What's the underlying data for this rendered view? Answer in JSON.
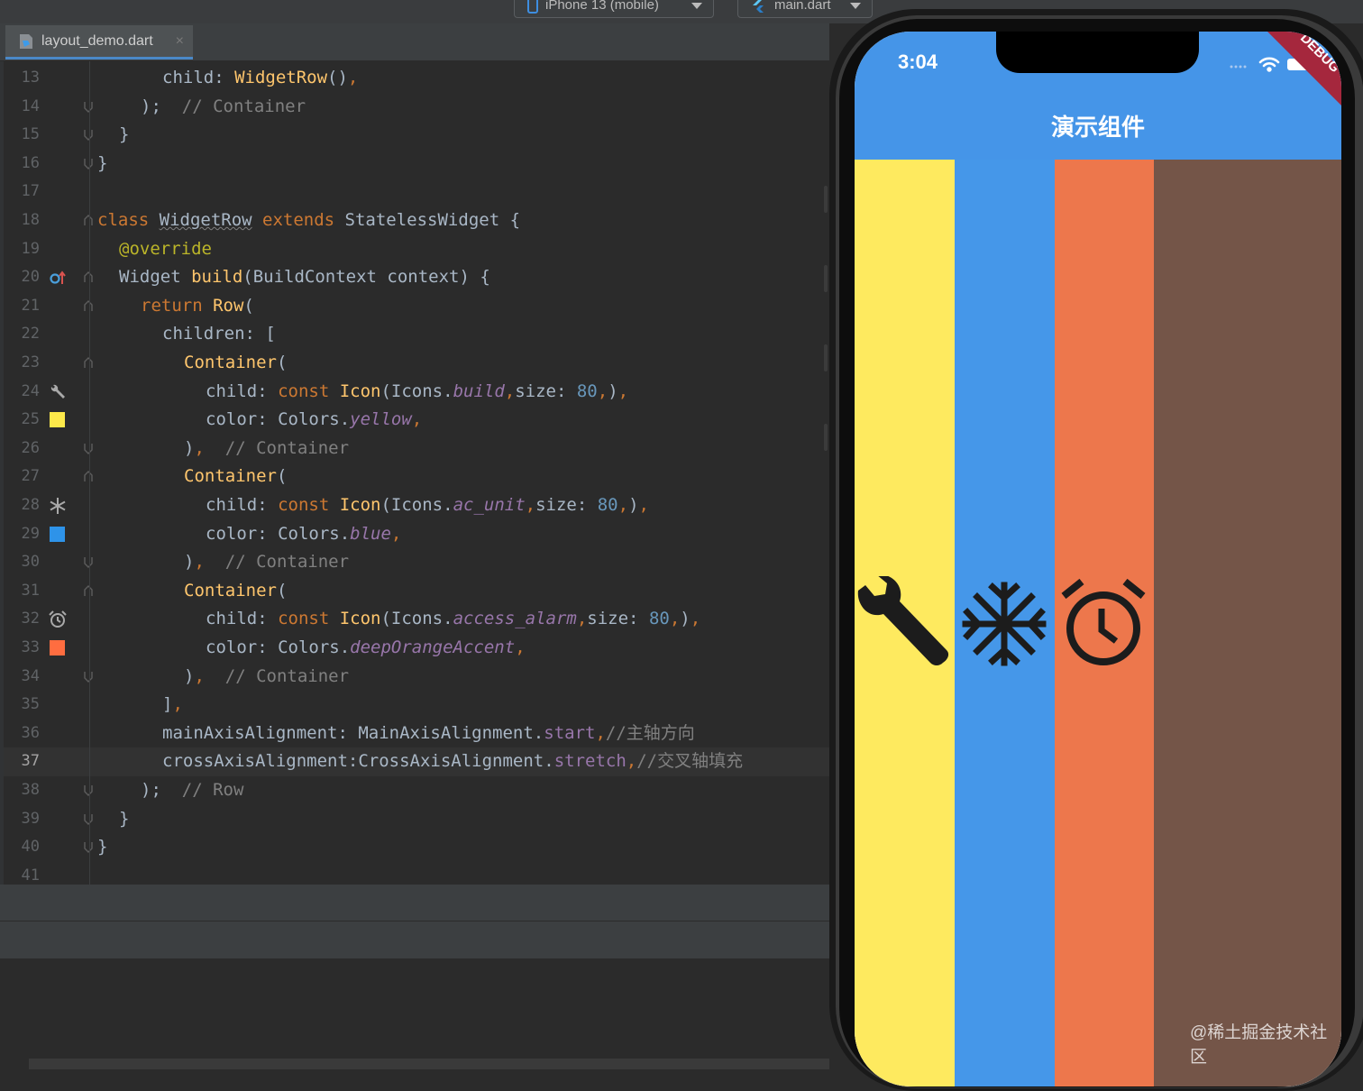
{
  "toolbar": {
    "device": "iPhone 13 (mobile)",
    "config": "main.dart"
  },
  "tab": {
    "filename": "layout_demo.dart",
    "close": "×"
  },
  "code_lines": [
    {
      "n": "13"
    },
    {
      "n": "14"
    },
    {
      "n": "15"
    },
    {
      "n": "16"
    },
    {
      "n": "17"
    },
    {
      "n": "18"
    },
    {
      "n": "19"
    },
    {
      "n": "20"
    },
    {
      "n": "21"
    },
    {
      "n": "22"
    },
    {
      "n": "23"
    },
    {
      "n": "24"
    },
    {
      "n": "25"
    },
    {
      "n": "26"
    },
    {
      "n": "27"
    },
    {
      "n": "28"
    },
    {
      "n": "29"
    },
    {
      "n": "30"
    },
    {
      "n": "31"
    },
    {
      "n": "32"
    },
    {
      "n": "33"
    },
    {
      "n": "34"
    },
    {
      "n": "35"
    },
    {
      "n": "36"
    },
    {
      "n": "37"
    },
    {
      "n": "38"
    },
    {
      "n": "39"
    },
    {
      "n": "40"
    },
    {
      "n": "41"
    }
  ],
  "code": {
    "l13": {
      "a": "child: ",
      "b": "WidgetRow",
      "c": "()",
      "d": ","
    },
    "l14": {
      "a": "); ",
      "b": "// Container"
    },
    "l15": {
      "a": "}"
    },
    "l16": {
      "a": "}"
    },
    "l18": {
      "a": "class ",
      "b": "WidgetRow",
      "c": " extends ",
      "d": "StatelessWidget {"
    },
    "l19": {
      "a": "@override"
    },
    "l20": {
      "a": "Widget ",
      "b": "build",
      "c": "(BuildContext context) {"
    },
    "l21": {
      "a": "return ",
      "b": "Row",
      "c": "("
    },
    "l22": {
      "a": "children: ["
    },
    "l23": {
      "a": "Container",
      "b": "("
    },
    "l24": {
      "a": "child: ",
      "b": "const ",
      "c": "Icon",
      "d": "(Icons.",
      "e": "build",
      "f": ",",
      "g": "size: ",
      "h": "80",
      "i": ",",
      "j": ")",
      "k": ","
    },
    "l25": {
      "a": "color: Colors.",
      "b": "yellow",
      "c": ","
    },
    "l26": {
      "a": ")",
      "b": ",  ",
      "c": "// Container"
    },
    "l27": {
      "a": "Container",
      "b": "("
    },
    "l28": {
      "a": "child: ",
      "b": "const ",
      "c": "Icon",
      "d": "(Icons.",
      "e": "ac_unit",
      "f": ",",
      "g": "size: ",
      "h": "80",
      "i": ",",
      "j": ")",
      "k": ","
    },
    "l29": {
      "a": "color: Colors.",
      "b": "blue",
      "c": ","
    },
    "l30": {
      "a": ")",
      "b": ",  ",
      "c": "// Container"
    },
    "l31": {
      "a": "Container",
      "b": "("
    },
    "l32": {
      "a": "child: ",
      "b": "const ",
      "c": "Icon",
      "d": "(Icons.",
      "e": "access_alarm",
      "f": ",",
      "g": "size: ",
      "h": "80",
      "i": ",",
      "j": ")",
      "k": ","
    },
    "l33": {
      "a": "color: Colors.",
      "b": "deepOrangeAccent",
      "c": ","
    },
    "l34": {
      "a": ")",
      "b": ",  ",
      "c": "// Container"
    },
    "l35": {
      "a": "]",
      "b": ","
    },
    "l36": {
      "a": "mainAxisAlignment: MainAxisAlignment.",
      "b": "start",
      "c": ",",
      "d": "//主轴方向"
    },
    "l37": {
      "a": "crossAxisAlignment:CrossAxisAlignment.",
      "b": "stretch",
      "c": ",",
      "d": "//交叉轴填充"
    },
    "l38": {
      "a": "); ",
      "b": "// Row"
    },
    "l39": {
      "a": "}"
    },
    "l40": {
      "a": "}"
    }
  },
  "phone": {
    "time": "3:04",
    "app_title": "演示组件",
    "debug_banner": "DEBUG",
    "columns": [
      {
        "name": "yellow",
        "color": "#feea5f",
        "icon": "build-icon"
      },
      {
        "name": "blue",
        "color": "#4597e9",
        "icon": "ac-unit-icon"
      },
      {
        "name": "deepOrangeAccent",
        "color": "#ed774c",
        "icon": "access-alarm-icon"
      },
      {
        "name": "brown",
        "color": "#745548",
        "icon": ""
      }
    ],
    "appbar_color": "#4595e8"
  },
  "watermark": "@稀土掘金技术社区"
}
